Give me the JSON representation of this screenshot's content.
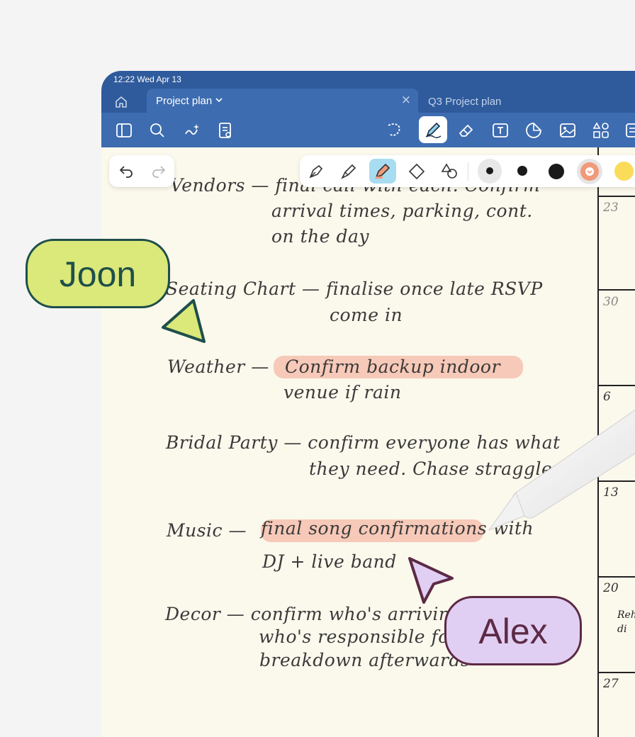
{
  "status_bar": {
    "time_date": "12:22  Wed Apr 13"
  },
  "tabs": [
    {
      "label": "Project plan",
      "close": "×"
    },
    {
      "label": "Q3 Project plan"
    }
  ],
  "notes": {
    "vendors_line1": "Vendors — final call with each. Confirm",
    "vendors_line2": "arrival times, parking, cont.",
    "vendors_line3": "on the day",
    "seating_line1": "Seating Chart — finalise once late RSVP",
    "seating_line2": "come in",
    "weather_label": "Weather —",
    "weather_line1": "Confirm backup indoor",
    "weather_line2": "venue if rain",
    "bridal_line1": "Bridal Party — confirm everyone has what",
    "bridal_line2": "they need. Chase stragglers",
    "music_label": "Music —",
    "music_line1": "final song confirmations with",
    "music_line2": "DJ + live band",
    "decor_line1": "Decor — confirm who's arriving",
    "decor_line2": "who's responsible for",
    "decor_line3": "breakdown afterwards"
  },
  "calendar": {
    "days": [
      "23",
      "30",
      "6",
      "13",
      "20",
      "27"
    ],
    "note_line1": "Reh",
    "note_line2": "di"
  },
  "collaborators": [
    {
      "name": "Joon",
      "color": "#dbe87a",
      "border": "#1e4f4a"
    },
    {
      "name": "Alex",
      "color": "#e1cff3",
      "border": "#5c2a45"
    }
  ],
  "colors": {
    "highlight": "#f7c9b8",
    "tab_bar": "#2f5b9c",
    "toolbar": "#3d6cb0",
    "paper": "#fbf8ec"
  },
  "icons": [
    "home-icon",
    "chevron-down-icon",
    "close-icon",
    "sidebar-icon",
    "search-icon",
    "ai-sparkle-icon",
    "document-icon",
    "lasso-icon",
    "pen-icon",
    "eraser-icon",
    "text-box-icon",
    "sticker-icon",
    "image-icon",
    "shapes-icon",
    "undo-icon",
    "redo-icon",
    "fountain-pen-icon",
    "brush-pen-icon",
    "highlighter-icon",
    "diamond-eraser-icon",
    "shape-tool-icon"
  ]
}
